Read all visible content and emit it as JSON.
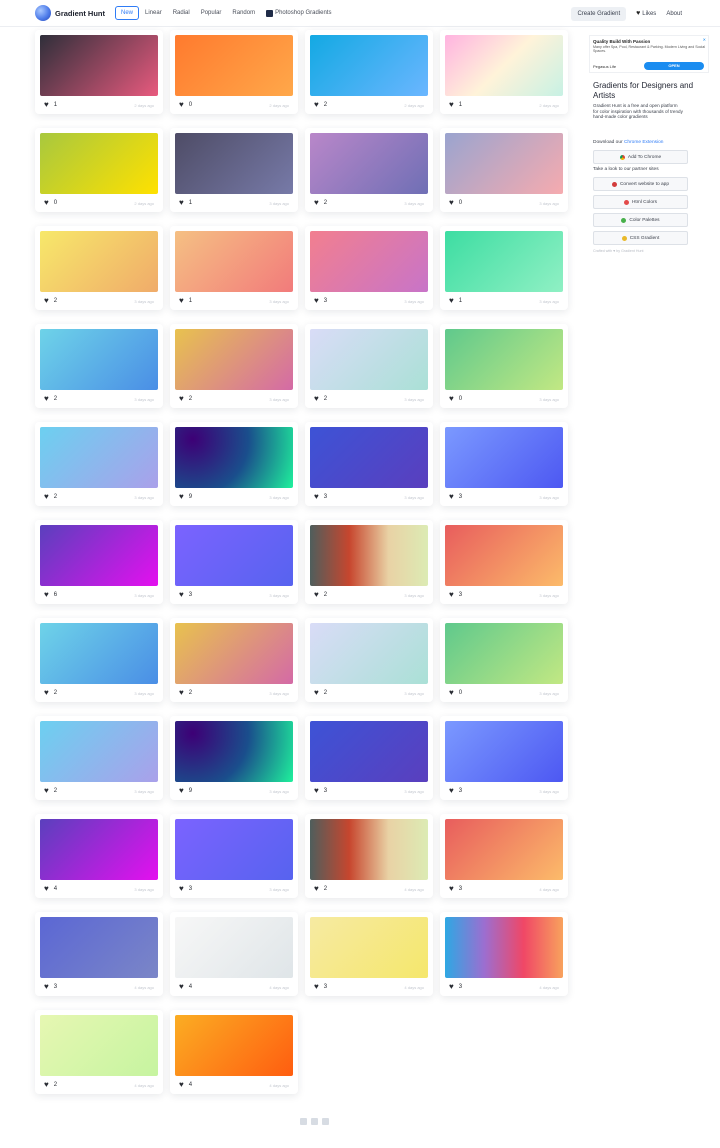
{
  "header": {
    "logo_text": "Gradient Hunt",
    "nav": [
      "New",
      "Linear",
      "Radial",
      "Popular",
      "Random"
    ],
    "ps_label": "Photoshop Gradients",
    "create_label": "Create Gradient",
    "likes_label": "Likes",
    "about_label": "About"
  },
  "gradients": [
    {
      "likes": "1",
      "time": "2 days ago",
      "colors": [
        "#2f2f3a",
        "#e85a7e"
      ]
    },
    {
      "likes": "0",
      "time": "2 days ago",
      "colors": [
        "#ff7a2e",
        "#ffa84a"
      ]
    },
    {
      "likes": "2",
      "time": "2 days ago",
      "colors": [
        "#13a9e3",
        "#6bb6ff"
      ]
    },
    {
      "likes": "1",
      "time": "2 days ago",
      "colors": [
        "#ffb3e0",
        "#fff3d9",
        "#c7f1e4"
      ]
    },
    {
      "likes": "0",
      "time": "2 days ago",
      "colors": [
        "#a8c83e",
        "#ffe100"
      ]
    },
    {
      "likes": "1",
      "time": "3 days ago",
      "colors": [
        "#4e4c66",
        "#777aa8"
      ]
    },
    {
      "likes": "2",
      "time": "3 days ago",
      "colors": [
        "#b987c9",
        "#6f6fb5"
      ]
    },
    {
      "likes": "0",
      "time": "3 days ago",
      "colors": [
        "#9aa4cf",
        "#f6abaf"
      ]
    },
    {
      "likes": "2",
      "time": "3 days ago",
      "colors": [
        "#f7e86a",
        "#f0ab6a"
      ]
    },
    {
      "likes": "1",
      "time": "3 days ago",
      "colors": [
        "#f5c083",
        "#f27b7b"
      ]
    },
    {
      "likes": "3",
      "time": "3 days ago",
      "colors": [
        "#f27f8f",
        "#c874c8"
      ]
    },
    {
      "likes": "1",
      "time": "3 days ago",
      "colors": [
        "#3ddda2",
        "#90f0c4"
      ]
    },
    {
      "likes": "2",
      "time": "3 days ago",
      "colors": [
        "#6ed3e8",
        "#4a8ee6"
      ]
    },
    {
      "likes": "2",
      "time": "3 days ago",
      "colors": [
        "#e8c24e",
        "#d46aa6"
      ]
    },
    {
      "likes": "2",
      "time": "3 days ago",
      "colors": [
        "#d9dcf7",
        "#aae0d6"
      ]
    },
    {
      "likes": "0",
      "time": "3 days ago",
      "colors": [
        "#5fc98c",
        "#c2e883"
      ]
    },
    {
      "likes": "2",
      "time": "3 days ago",
      "colors": [
        "#6cd0f0",
        "#aaa0ea"
      ]
    },
    {
      "likes": "9",
      "time": "3 days ago",
      "colors": [
        "#3d0076",
        "#1a4e8c",
        "#1ff19c"
      ],
      "radial": true
    },
    {
      "likes": "3",
      "time": "3 days ago",
      "colors": [
        "#3d53d6",
        "#5a3fbe"
      ]
    },
    {
      "likes": "3",
      "time": "3 days ago",
      "colors": [
        "#7b99ff",
        "#4d58f2"
      ]
    },
    {
      "likes": "6",
      "time": "3 days ago",
      "colors": [
        "#5a40bd",
        "#e410ef"
      ]
    },
    {
      "likes": "3",
      "time": "3 days ago",
      "colors": [
        "#7b63ff",
        "#5763ef"
      ]
    },
    {
      "likes": "2",
      "time": "3 days ago",
      "colors": [
        "#4f5e5c",
        "#c7462e",
        "#e9d2a5",
        "#dcebb4"
      ]
    },
    {
      "likes": "3",
      "time": "3 days ago",
      "colors": [
        "#e85d5d",
        "#fcbb6a"
      ]
    },
    {
      "likes": "2",
      "time": "3 days ago",
      "colors": [
        "#6ed3e8",
        "#4a8ee6"
      ]
    },
    {
      "likes": "2",
      "time": "3 days ago",
      "colors": [
        "#e8c24e",
        "#d46aa6"
      ]
    },
    {
      "likes": "2",
      "time": "3 days ago",
      "colors": [
        "#d9dcf7",
        "#aae0d6"
      ]
    },
    {
      "likes": "0",
      "time": "3 days ago",
      "colors": [
        "#5fc98c",
        "#c2e883"
      ]
    },
    {
      "likes": "2",
      "time": "3 days ago",
      "colors": [
        "#6cd0f0",
        "#aaa0ea"
      ]
    },
    {
      "likes": "9",
      "time": "3 days ago",
      "colors": [
        "#3d0076",
        "#1a4e8c",
        "#1ff19c"
      ],
      "radial": true
    },
    {
      "likes": "3",
      "time": "3 days ago",
      "colors": [
        "#3d53d6",
        "#5a3fbe"
      ]
    },
    {
      "likes": "3",
      "time": "3 days ago",
      "colors": [
        "#7b99ff",
        "#4d58f2"
      ]
    },
    {
      "likes": "4",
      "time": "3 days ago",
      "colors": [
        "#5a40bd",
        "#e410ef"
      ]
    },
    {
      "likes": "3",
      "time": "3 days ago",
      "colors": [
        "#7b63ff",
        "#5763ef"
      ]
    },
    {
      "likes": "2",
      "time": "4 days ago",
      "colors": [
        "#4f5e5c",
        "#c7462e",
        "#e9d2a5",
        "#dcebb4"
      ]
    },
    {
      "likes": "3",
      "time": "4 days ago",
      "colors": [
        "#e85d5d",
        "#fcbb6a"
      ]
    },
    {
      "likes": "3",
      "time": "4 days ago",
      "colors": [
        "#5b67d4",
        "#7b86c7"
      ]
    },
    {
      "likes": "4",
      "time": "4 days ago",
      "colors": [
        "#f7f7f7",
        "#dfe5e8"
      ]
    },
    {
      "likes": "3",
      "time": "4 days ago",
      "colors": [
        "#f6eaa2",
        "#f5e76c"
      ]
    },
    {
      "likes": "3",
      "time": "4 days ago",
      "colors": [
        "#2ea8e3",
        "#9c6ed0",
        "#f04766",
        "#f8a25d"
      ]
    },
    {
      "likes": "2",
      "time": "4 days ago",
      "colors": [
        "#e6f7b2",
        "#c6f4a0"
      ]
    },
    {
      "likes": "4",
      "time": "4 days ago",
      "colors": [
        "#fbad23",
        "#ff5d10"
      ]
    }
  ],
  "sidebar": {
    "ad_title": "Quality Build With Passion",
    "ad_text": "Many offer Spa, Pool, Restaurant & Parking. Modern Living and Social Spaces.",
    "ad_brand": "Pegasus Life",
    "ad_open": "OPEN",
    "ad_close": "✕",
    "title": "Gradients for Designers and Artists",
    "desc": "Gradient Hunt is a free and open platform for color inspiration with thousands of trendy hand-made color gradients",
    "download_prefix": "Download our",
    "download_link": "Chrome Extension",
    "chrome_btn": "Add To Chrome",
    "partner_label": "Take a look to our partner sites",
    "partners": [
      {
        "label": "Convert website to app",
        "color": "#d23c3c"
      },
      {
        "label": "Html Colors",
        "color": "#e34a4a"
      },
      {
        "label": "Color Palettes",
        "color": "#47b04a"
      },
      {
        "label": "CSS Gradient",
        "color": "#e9b92a"
      }
    ],
    "footer": "Crafted with ♥ by Gradient Hunt"
  },
  "pager_count": 3
}
